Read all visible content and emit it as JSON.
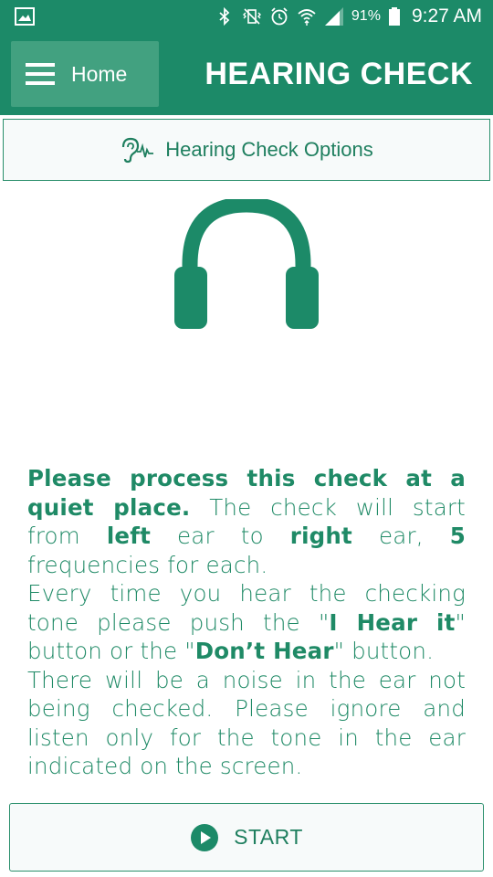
{
  "status_bar": {
    "battery_percent": "91%",
    "time": "9:27 AM",
    "icons": [
      "gallery-icon",
      "bluetooth-icon",
      "vibrate-icon",
      "alarm-icon",
      "wifi-icon",
      "signal-icon",
      "battery-icon"
    ]
  },
  "header": {
    "home_label": "Home",
    "title": "HEARING CHECK"
  },
  "options": {
    "label": "Hearing Check Options"
  },
  "instructions": {
    "p1_bold": "Please process this check at a quiet place.",
    "p1_a": " The check will start from ",
    "p1_left": "left",
    "p1_b": " ear to ",
    "p1_right": "right",
    "p1_c": " ear, ",
    "p1_num": "5",
    "p1_d": " frequencies for each.",
    "p2_a": "Every time you hear the checking tone please push the \"",
    "p2_hear": "I Hear it",
    "p2_b": "\" button or the \"",
    "p2_dont": "Don’t Hear",
    "p2_c": "\" button.",
    "p3": "There will be a noise in the ear not being checked. Please ignore and listen only for the tone in the ear indicated on the screen."
  },
  "start_button": {
    "label": "START"
  },
  "colors": {
    "primary": "#1c8a68",
    "primary_light": "#42a180",
    "text_green": "#1f8a66"
  }
}
